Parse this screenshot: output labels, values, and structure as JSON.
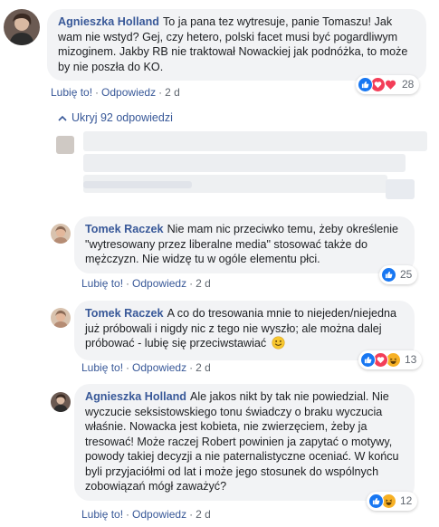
{
  "comments": [
    {
      "author": "Agnieszka Holland",
      "text": "To ja pana tez wytresuje, panie Tomaszu! Jak wam nie wstyd? Gej, czy hetero, polski facet musi być pogardliwym mizoginem. Jakby RB nie traktował Nowackiej jak podnóżka, to może by nie poszła do KO.",
      "like_label": "Lubię to!",
      "reply_label": "Odpowiedz",
      "time": "2 d",
      "reaction_count": "28",
      "reactions": [
        "like",
        "love",
        "heart"
      ]
    },
    {
      "author": "Tomek Raczek",
      "text": "Nie mam nic przeciwko temu, żeby określenie \"wytresowany przez liberalne media\" stosować także do mężczyzn. Nie widzę tu w ogóle elementu płci.",
      "like_label": "Lubię to!",
      "reply_label": "Odpowiedz",
      "time": "2 d",
      "reaction_count": "25",
      "reactions": [
        "like"
      ]
    },
    {
      "author": "Tomek Raczek",
      "text": "A co do tresowania mnie to niejeden/niejedna już próbowali i nigdy nic z tego nie wyszło; ale można dalej próbować - lubię się przeciwstawiać",
      "emoji": "smile-emoji",
      "like_label": "Lubię to!",
      "reply_label": "Odpowiedz",
      "time": "2 d",
      "reaction_count": "13",
      "reactions": [
        "like",
        "love",
        "haha"
      ]
    },
    {
      "author": "Agnieszka Holland",
      "text": "Ale jakos nikt by tak nie powiedzial. Nie wyczucie seksistowskiego tonu świadczy o braku wyczucia właśnie. Nowacka jest kobieta, nie zwierzęciem, żeby ja tresować! Może raczej Robert powinien ja zapytać o motywy, powody takiej decyzji a nie paternalistyczne oceniać. W końcu byli przyjaciółmi od lat i może jego stosunek do wspólnych zobowiązań mógł zaważyć?",
      "like_label": "Lubię to!",
      "reply_label": "Odpowiedz",
      "time": "2 d",
      "reaction_count": "12",
      "reactions": [
        "like",
        "haha"
      ]
    }
  ],
  "hide_replies_label": "Ukryj 92 odpowiedzi",
  "colors": {
    "link": "#385898",
    "bubble": "#f2f3f5",
    "like_blue": "#1877f2",
    "love_red": "#f33e58",
    "haha_yellow": "#f7b125"
  }
}
